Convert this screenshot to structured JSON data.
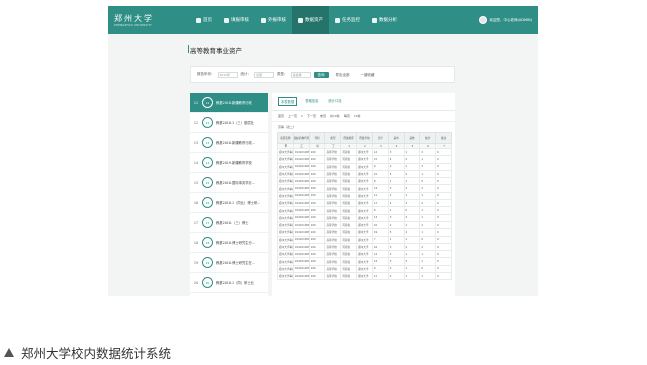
{
  "logo": {
    "name": "郑州大学",
    "subtitle": "ZHENGZHOU UNIVERSITY"
  },
  "nav": {
    "items": [
      {
        "label": "首页",
        "icon": "home-icon"
      },
      {
        "label": "填报审核",
        "icon": "edit-icon"
      },
      {
        "label": "外报审核",
        "icon": "check-icon"
      },
      {
        "label": "数据资产",
        "icon": "data-icon",
        "active": true
      },
      {
        "label": "任务监控",
        "icon": "monitor-icon"
      },
      {
        "label": "数据分析",
        "icon": "chart-icon"
      }
    ],
    "user_text": "欢迎您，中心老师(ADMIN)"
  },
  "page_title": "高等教育事业资产",
  "filters": {
    "year_label": "报告年份：",
    "year_value": "2022年",
    "scope_label": "统计：",
    "scope_value": "全部",
    "type_label": "类型：",
    "type_value": "请选择",
    "query_label": "查询",
    "reset_label": "导出全部",
    "more_label": "一键收藏"
  },
  "left_list": [
    {
      "num": "11",
      "ring": "11",
      "label": "教基2018.新疆教育行政",
      "active": true
    },
    {
      "num": "12",
      "ring": "12",
      "label": "教基2018.1（三）基层社"
    },
    {
      "num": "13",
      "ring": "13",
      "label": "教基2018.新疆教育行政..."
    },
    {
      "num": "14",
      "ring": "14",
      "label": "教基2019.新疆教育学校"
    },
    {
      "num": "15",
      "ring": "15",
      "label": "教基2018.国际事务学办..."
    },
    {
      "num": "16",
      "ring": "16",
      "label": "教基2018.1（同比）博士研..."
    },
    {
      "num": "17",
      "ring": "17",
      "label": "教基2018.（三）博士"
    },
    {
      "num": "18",
      "ring": "18",
      "label": "教基2018.博士研究生分..."
    },
    {
      "num": "19",
      "ring": "19",
      "label": "教基2018.博士研究生在..."
    },
    {
      "num": "20",
      "ring": "20",
      "label": "教基2018.1（同）研士业"
    }
  ],
  "tabs": [
    "本表数据",
    "表格信息",
    "统计口径"
  ],
  "toolbar": [
    "首页",
    "上一页",
    "1",
    "下一页",
    "末页",
    "共10条",
    "每页",
    "10条"
  ],
  "table_caption": "高等（表二）",
  "table": {
    "headers": [
      "项目名称",
      "组织机构代码",
      "代码",
      "类型",
      "所属地区",
      "所属学校",
      "合计",
      "其中",
      "其他",
      "统计",
      "备注"
    ],
    "index_row": [
      "甲",
      "乙",
      "丙",
      "丁",
      "1",
      "2",
      "3",
      "4",
      "5",
      "6",
      "7"
    ],
    "rows": [
      [
        "郑州大学事业单位",
        "91410100MA46",
        "100",
        "高等学校",
        "河南省",
        "郑州大学",
        "12",
        "3",
        "1",
        "2",
        "0"
      ],
      [
        "郑州大学事业单位",
        "91410100MA46",
        "100",
        "高等学校",
        "河南省",
        "郑州大学",
        "15",
        "4",
        "2",
        "1",
        "0"
      ],
      [
        "郑州大学事业单位",
        "91410100MA46",
        "100",
        "高等学校",
        "河南省",
        "郑州大学",
        "9",
        "2",
        "1",
        "3",
        "0"
      ],
      [
        "郑州大学事业单位",
        "91410100MA46",
        "100",
        "高等学校",
        "河南省",
        "郑州大学",
        "21",
        "5",
        "2",
        "1",
        "0"
      ],
      [
        "郑州大学事业单位",
        "91410100MA46",
        "100",
        "高等学校",
        "河南省",
        "郑州大学",
        "8",
        "1",
        "1",
        "0",
        "0"
      ],
      [
        "郑州大学事业单位",
        "91410100MA46",
        "100",
        "高等学校",
        "河南省",
        "郑州大学",
        "14",
        "3",
        "2",
        "2",
        "0"
      ],
      [
        "郑州大学事业单位",
        "91410100MA46",
        "100",
        "高等学校",
        "河南省",
        "郑州大学",
        "11",
        "2",
        "1",
        "1",
        "0"
      ],
      [
        "郑州大学事业单位",
        "91410100MA46",
        "100",
        "高等学校",
        "河南省",
        "郑州大学",
        "17",
        "4",
        "3",
        "2",
        "0"
      ],
      [
        "郑州大学事业单位",
        "91410100MA46",
        "100",
        "高等学校",
        "河南省",
        "郑州大学",
        "6",
        "1",
        "0",
        "1",
        "0"
      ],
      [
        "郑州大学事业单位",
        "91410100MA46",
        "100",
        "高等学校",
        "河南省",
        "郑州大学",
        "13",
        "3",
        "2",
        "1",
        "0"
      ],
      [
        "郑州大学事业单位",
        "91410100MA46",
        "100",
        "高等学校",
        "河南省",
        "郑州大学",
        "10",
        "2",
        "1",
        "2",
        "0"
      ],
      [
        "郑州大学事业单位",
        "91410100MA46",
        "100",
        "高等学校",
        "河南省",
        "郑州大学",
        "19",
        "5",
        "2",
        "1",
        "0"
      ],
      [
        "郑州大学事业单位",
        "91410100MA46",
        "100",
        "高等学校",
        "河南省",
        "郑州大学",
        "7",
        "1",
        "1",
        "0",
        "0"
      ],
      [
        "郑州大学事业单位",
        "91410100MA46",
        "100",
        "高等学校",
        "河南省",
        "郑州大学",
        "16",
        "3",
        "2",
        "2",
        "0"
      ],
      [
        "郑州大学事业单位",
        "91410100MA46",
        "100",
        "高等学校",
        "河南省",
        "郑州大学",
        "12",
        "2",
        "1",
        "1",
        "0"
      ],
      [
        "郑州大学事业单位",
        "91410100MA46",
        "100",
        "高等学校",
        "河南省",
        "郑州大学",
        "14",
        "3",
        "2",
        "1",
        "0"
      ],
      [
        "郑州大学事业单位",
        "91410100MA46",
        "100",
        "高等学校",
        "河南省",
        "郑州大学",
        "9",
        "2",
        "1",
        "0",
        "0"
      ],
      [
        "郑州大学事业单位",
        "91410100MA46",
        "100",
        "高等学校",
        "河南省",
        "郑州大学",
        "11",
        "2",
        "1",
        "1",
        "0"
      ]
    ]
  },
  "caption": "郑州大学校内数据统计系统",
  "colors": {
    "brand": "#2f8f86",
    "brand_dark": "#24746c"
  }
}
